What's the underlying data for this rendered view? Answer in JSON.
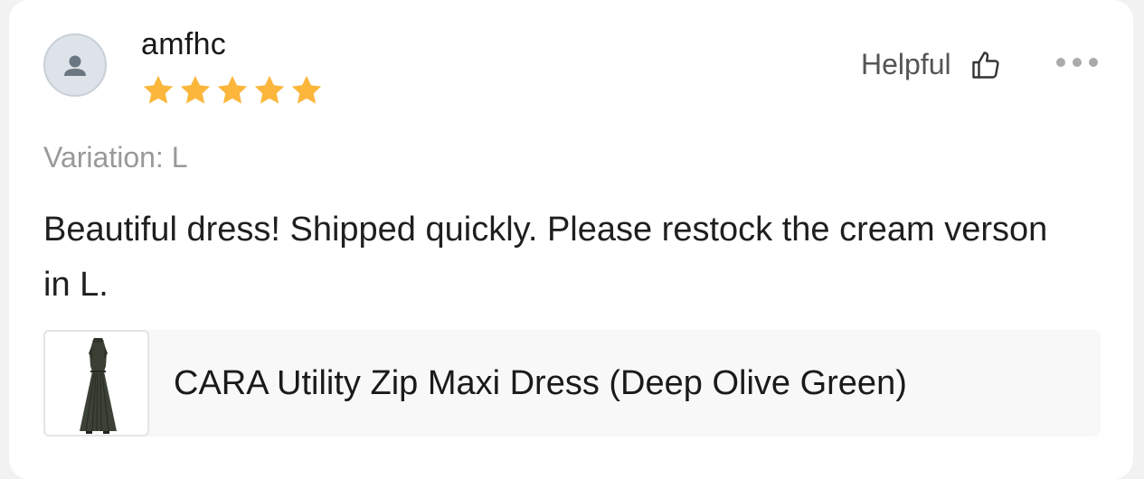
{
  "review": {
    "username": "amfhc",
    "rating": 5,
    "rating_max": 5,
    "star_color": "#fbb63b",
    "helpful_label": "Helpful",
    "variation": "Variation: L",
    "text": "Beautiful dress! Shipped quickly. Please restock the cream verson in L.",
    "product_name": "CARA Utility Zip Maxi Dress (Deep Olive Green)"
  },
  "icons": {
    "avatar": "user-avatar-icon",
    "helpful": "thumbs-up-icon",
    "more": "more-horizontal-icon",
    "star": "star-icon"
  }
}
